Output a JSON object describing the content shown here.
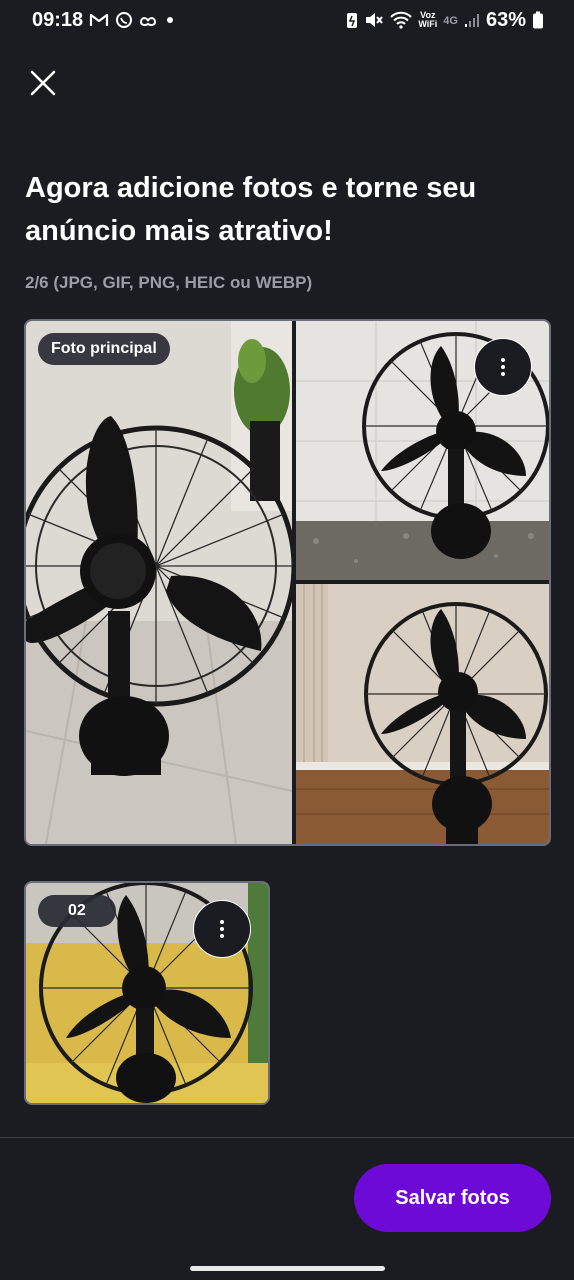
{
  "status_bar": {
    "time": "09:18",
    "notification_icons": [
      "gmail-icon",
      "whatsapp-icon",
      "app-icon",
      "dot-icon"
    ],
    "voz_top": "Voz",
    "voz_bottom": "WiFi",
    "network": "4G",
    "battery_percent": "63%"
  },
  "page": {
    "title": "Agora adicione fotos e torne seu anúncio mais atrativo!",
    "subtitle": "2/6 (JPG, GIF, PNG, HEIC ou WEBP)"
  },
  "photos": [
    {
      "badge": "Foto principal",
      "menu_icon": "more-vertical-icon"
    },
    {
      "badge": "02",
      "menu_icon": "more-vertical-icon"
    }
  ],
  "footer": {
    "save_label": "Salvar fotos"
  },
  "colors": {
    "background": "#1b1c22",
    "primary_button": "#6e0ad6",
    "subtitle": "#9b9ca6"
  }
}
